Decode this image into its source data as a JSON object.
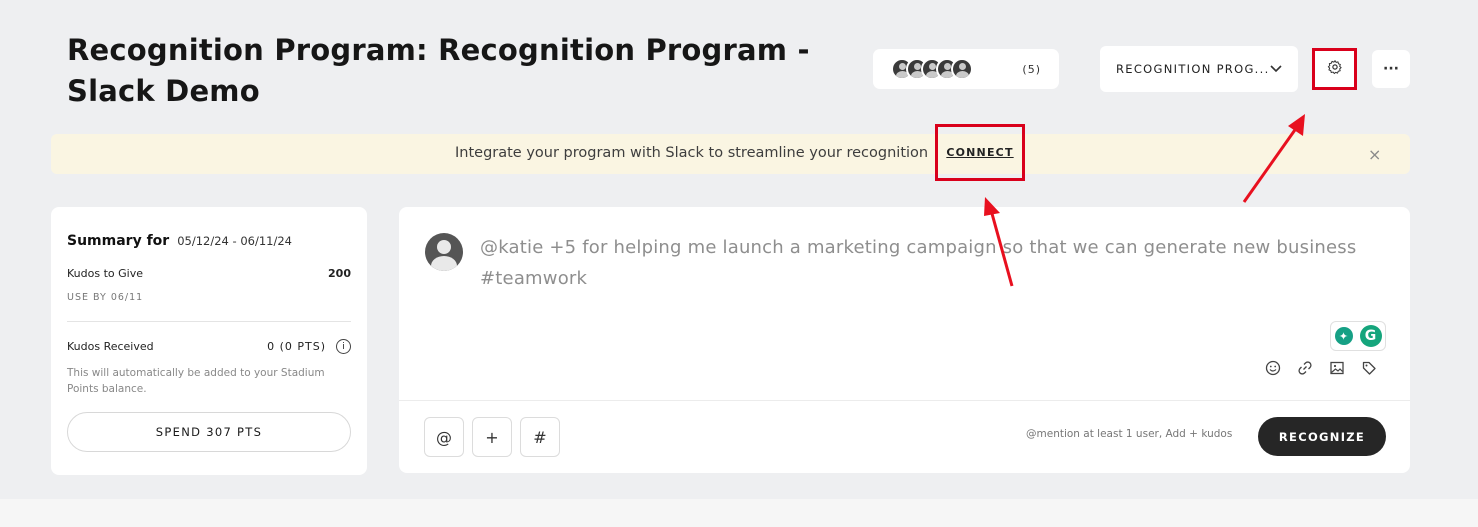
{
  "header": {
    "title": "Recognition Program: Recognition Program - Slack Demo",
    "members_count": "(5)",
    "program_select": "RECOGNITION PROG...",
    "more_label": "···"
  },
  "banner": {
    "text": "Integrate your program with Slack to streamline your recognition",
    "connect_label": "CONNECT",
    "close_label": "×"
  },
  "summary": {
    "title": "Summary for",
    "date_range": "05/12/24 - 06/11/24",
    "kudos_to_give_label": "Kudos to Give",
    "kudos_to_give_value": "200",
    "use_by": "USE BY 06/11",
    "kudos_received_label": "Kudos Received",
    "kudos_received_value": "0 (0 PTS)",
    "note": "This will automatically be added to your Stadium Points balance.",
    "spend_button": "SPEND 307 PTS"
  },
  "composer": {
    "placeholder": "@katie +5 for helping me launch a marketing campaign so that we can generate new business #teamwork",
    "mention_btn": "@",
    "kudos_btn": "+",
    "hashtag_btn": "#",
    "helper": "@mention at least 1 user,  Add + kudos",
    "recognize_button": "RECOGNIZE"
  },
  "colors": {
    "highlight_red": "#d9001b",
    "banner_bg": "#faf5e2",
    "page_bg": "#eeeff1",
    "primary_button": "#262626"
  }
}
